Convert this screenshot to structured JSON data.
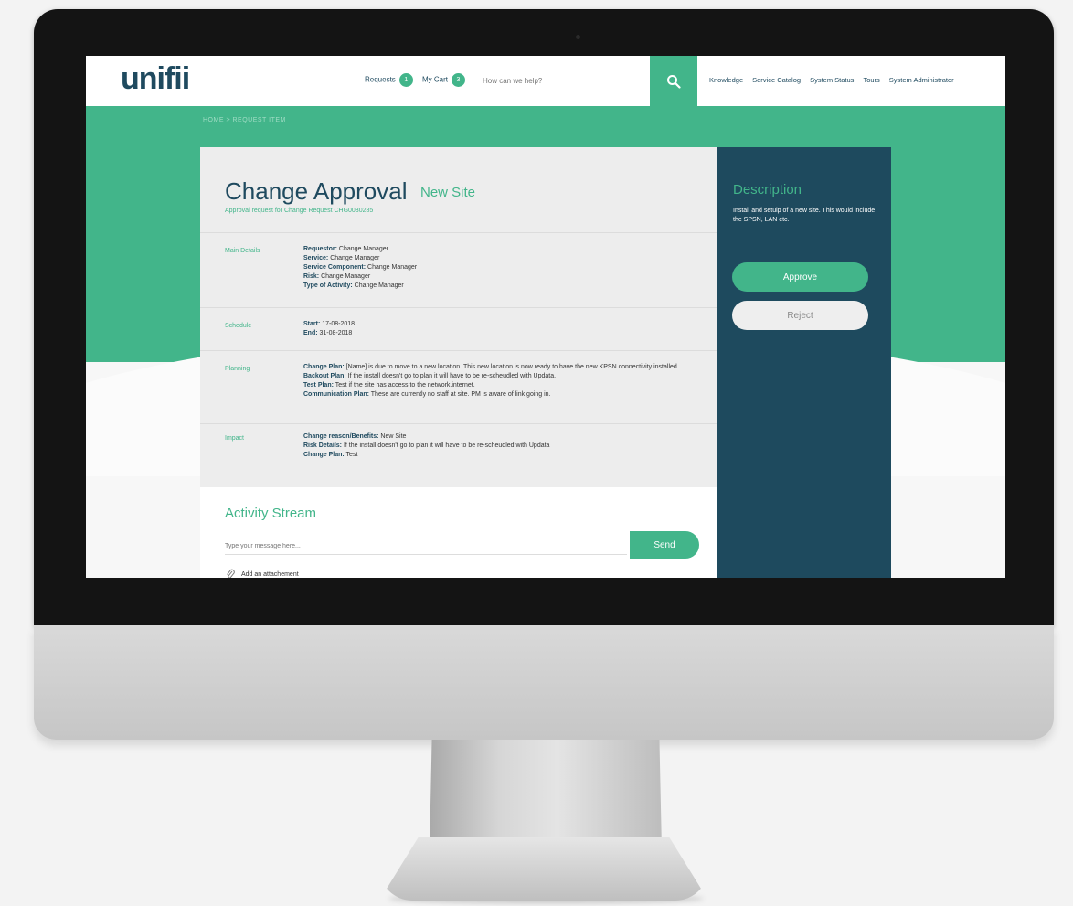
{
  "nav": {
    "logo": "unifii",
    "requests_label": "Requests",
    "requests_count": "1",
    "cart_label": "My Cart",
    "cart_count": "3",
    "search_placeholder": "How can we help?",
    "links": [
      "Knowledge",
      "Service Catalog",
      "System Status",
      "Tours",
      "System Administrator"
    ]
  },
  "breadcrumb": "HOME  >  REQUEST ITEM",
  "page": {
    "title": "Change Approval",
    "subtitle": "New Site",
    "note": "Approval request for Change Request CHG0030285"
  },
  "sections": [
    {
      "label": "Main Details",
      "lines": [
        {
          "k": "Requestor:",
          "v": " Change Manager"
        },
        {
          "k": "Service:",
          "v": " Change Manager"
        },
        {
          "k": "Service Component:",
          "v": " Change Manager"
        },
        {
          "k": "Risk:",
          "v": " Change Manager"
        },
        {
          "k": "Type of Activity:",
          "v": " Change Manager"
        }
      ]
    },
    {
      "label": "Schedule",
      "lines": [
        {
          "k": "Start:",
          "v": " 17-08-2018"
        },
        {
          "k": "End:",
          "v": " 31-08-2018"
        }
      ]
    },
    {
      "label": "Planning",
      "lines": [
        {
          "k": "Change Plan:",
          "v": " [Name] is due to move to a new location. This new location is now ready to have the new KPSN connectivity installed."
        },
        {
          "k": "Backout Plan:",
          "v": " If the install doesn't go to plan it will have to be re-scheudled with Updata."
        },
        {
          "k": "Test Plan:",
          "v": " Test if the site has access to the network.internet."
        },
        {
          "k": "Communication Plan:",
          "v": " These are currently no staff at site. PM is aware of link going in."
        }
      ]
    },
    {
      "label": "Impact",
      "lines": [
        {
          "k": "Change reason/Benefits:",
          "v": " New Site"
        },
        {
          "k": "Risk Details:",
          "v": " If the install doesn't go to plan it will have to be re-scheudled with Updata"
        },
        {
          "k": "Change Plan:",
          "v": " Test"
        }
      ]
    }
  ],
  "activity": {
    "title": "Activity Stream",
    "input_placeholder": "Type your message here...",
    "send_label": "Send",
    "attach_label": "Add an attachement"
  },
  "side": {
    "title": "Description",
    "text": "Install  and setuip of a new site. This would include the SPSN, LAN etc.",
    "approve_label": "Approve",
    "reject_label": "Reject"
  },
  "colors": {
    "accent": "#42b58a",
    "navy": "#1e4a5e"
  }
}
